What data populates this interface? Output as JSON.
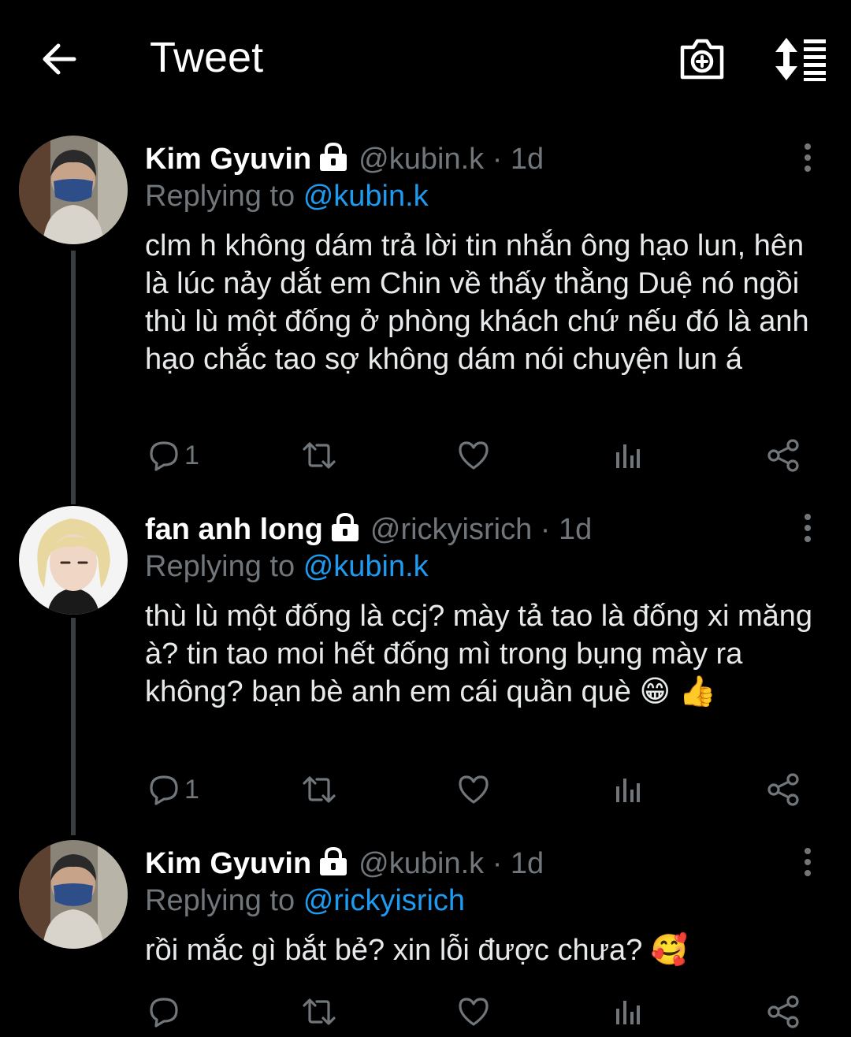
{
  "header": {
    "title": "Tweet",
    "back_icon": "arrow-left-icon",
    "camera_icon": "camera-plus-icon",
    "sort_icon": "sort-icon"
  },
  "colors": {
    "background": "#000000",
    "text": "#e7e9ea",
    "muted": "#71767b",
    "link": "#1d9bf0",
    "thread_line": "#3a3d40"
  },
  "tweets": [
    {
      "name": "Kim Gyuvin",
      "handle": "@kubin.k",
      "time": "· 1d",
      "reply_prefix": "Replying to",
      "reply_to": "@kubin.k",
      "text": "clm h không dám trả lời tin nhắn ông hạo lun, hên là lúc nảy dắt em Chin về thấy thằng Duệ nó ngồi thù lù một đống ở phòng khách chứ nếu đó là anh hạo chắc tao sợ không dám nói chuyện lun á",
      "reply_count": "1"
    },
    {
      "name": "fan anh long",
      "handle": "@rickyisrich",
      "time": "· 1d",
      "reply_prefix": "Replying to",
      "reply_to": "@kubin.k",
      "text": "thù lù một đống là ccj? mày tả tao là đống xi măng à? tin tao moi hết đống mì trong bụng mày ra không? bạn bè anh em cái quần què 😁 👍",
      "reply_count": "1"
    },
    {
      "name": "Kim Gyuvin",
      "handle": "@kubin.k",
      "time": "· 1d",
      "reply_prefix": "Replying to",
      "reply_to": "@rickyisrich",
      "text": "rồi mắc gì bắt bẻ? xin lỗi được chưa? 🥰",
      "reply_count": ""
    }
  ]
}
